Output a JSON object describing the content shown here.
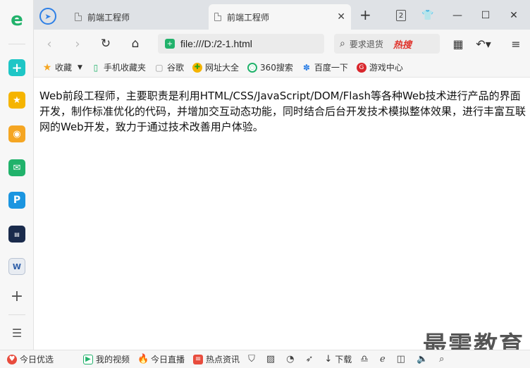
{
  "window": {
    "tabs": [
      {
        "label": "前端工程师",
        "active": false
      },
      {
        "label": "前端工程师",
        "active": true
      }
    ],
    "tab_count_badge": "2"
  },
  "toolbar": {
    "url": "file:///D:/2-1.html",
    "search_placeholder": "要求退货",
    "search_hot_label": "热搜"
  },
  "bookmarks": [
    {
      "label": "收藏",
      "icon": "star-icon",
      "color": "#f5a623"
    },
    {
      "label": "手机收藏夹",
      "icon": "phone-icon",
      "color": "#21b26b"
    },
    {
      "label": "谷歌",
      "icon": "doc-icon",
      "color": "#999999"
    },
    {
      "label": "网址大全",
      "icon": "globe-icon",
      "color": "#2aa515"
    },
    {
      "label": "360搜索",
      "icon": "search-360-icon",
      "color": "#21b26b"
    },
    {
      "label": "百度一下",
      "icon": "baidu-paw-icon",
      "color": "#2e80e6"
    },
    {
      "label": "游戏中心",
      "icon": "game-icon",
      "color": "#d9262c"
    }
  ],
  "content": {
    "paragraph": "Web前段工程师，主要职责是利用HTML/CSS/JavaScript/DOM/Flash等各种Web技术进行产品的界面开发，制作标准优化的代码，并增加交互动态功能，同时结合后台开发技术模拟整体效果，进行丰富互联网的Web开发，致力于通过技术改善用户体验。"
  },
  "watermark": "最需教育",
  "statusbar": {
    "items": [
      {
        "label": "今日优选",
        "icon": "heart-icon",
        "color": "#e84c3d"
      },
      {
        "label": "我的视频",
        "icon": "video-icon",
        "color": "#21b26b"
      },
      {
        "label": "今日直播",
        "icon": "fire-icon",
        "color": "#f06a25"
      },
      {
        "label": "热点资讯",
        "icon": "news-icon",
        "color": "#e84c3d"
      }
    ],
    "download_label": "下载"
  },
  "sidebar": {
    "icons": [
      {
        "name": "browser-logo-icon",
        "color": "#21b26b"
      },
      {
        "name": "medical-cross-icon",
        "color": "#1ec6c6"
      },
      {
        "name": "favorite-star-icon",
        "color": "#f5b400"
      },
      {
        "name": "weibo-icon",
        "color": "#f5a623"
      },
      {
        "name": "mail-icon",
        "color": "#21b26b"
      },
      {
        "name": "ip-icon",
        "color": "#1b95e0"
      },
      {
        "name": "news-app-icon",
        "color": "#1a2b4c"
      },
      {
        "name": "word-doc-icon",
        "color": "#e8ecf2"
      },
      {
        "name": "add-icon",
        "color": "#555555"
      },
      {
        "name": "menu-list-icon",
        "color": "#555555"
      }
    ]
  }
}
